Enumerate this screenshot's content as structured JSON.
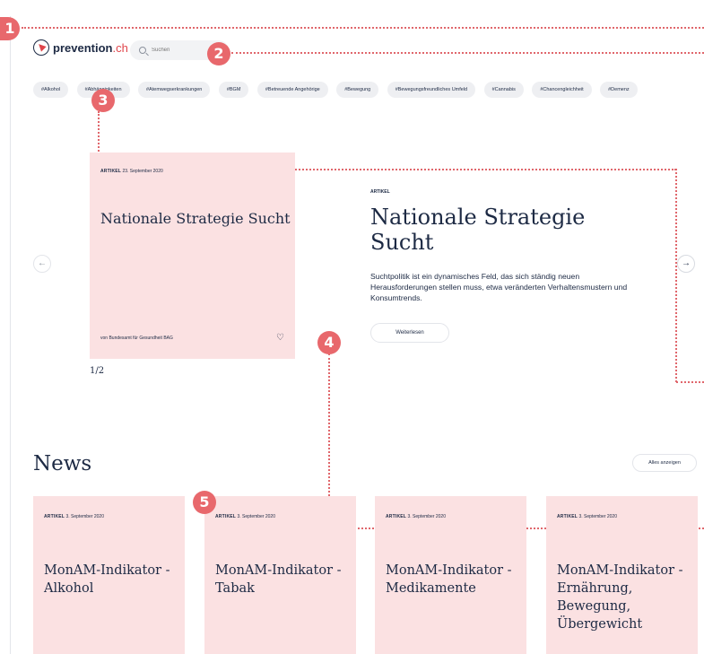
{
  "header": {
    "logo_name": "prevention",
    "logo_tld": ".ch",
    "search_placeholder": "Suchen"
  },
  "tags": [
    "#Alkohol",
    "#Abhängigkeiten",
    "#Atemwegserkrankungen",
    "#BGM",
    "#Betreuende Angehörige",
    "#Bewegung",
    "#Bewegungsfreundliches Umfeld",
    "#Cannabis",
    "#Chancengleichheit",
    "#Demenz"
  ],
  "hero": {
    "card_type": "ARTIKEL",
    "card_date": "23. September 2020",
    "card_title": "Nationale Strategie Sucht",
    "card_source": "von Bundesamt für Gesundheit BAG",
    "pager": "1/2",
    "label": "ARTIKEL",
    "title": "Nationale Strategie Sucht",
    "text": "Suchtpolitik ist ein dynamisches Feld, das sich ständig neuen Herausforderungen stellen muss, etwa veränderten Verhaltensmustern und Konsumtrends.",
    "read_more": "Weiterlesen",
    "prev_arrow": "←",
    "next_arrow": "→",
    "heart": "♡"
  },
  "news": {
    "title": "News",
    "all_button": "Alles anzeigen",
    "items": [
      {
        "type": "ARTIKEL",
        "date": "3. September 2020",
        "title": "MonAM-Indikator - Alkohol"
      },
      {
        "type": "ARTIKEL",
        "date": "3. September 2020",
        "title": "MonAM-Indikator - Tabak"
      },
      {
        "type": "ARTIKEL",
        "date": "3. September 2020",
        "title": "MonAM-Indikator - Medikamente"
      },
      {
        "type": "ARTIKEL",
        "date": "3. September 2020",
        "title": "MonAM-Indikator - Ernährung, Bewegung, Übergewicht"
      }
    ]
  },
  "markers": [
    "1",
    "2",
    "3",
    "4",
    "5"
  ],
  "colors": {
    "accent": "#e8686c",
    "card_bg": "#fbe1e2",
    "text": "#1d2a44"
  }
}
